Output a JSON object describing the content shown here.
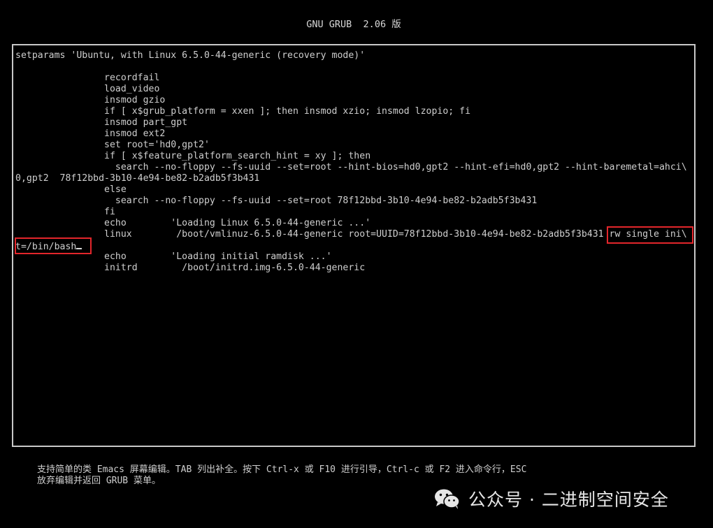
{
  "header": {
    "title": "GNU GRUB  2.06 版"
  },
  "editor": {
    "lines": [
      "setparams 'Ubuntu, with Linux 6.5.0-44-generic (recovery mode)'",
      "",
      "                recordfail",
      "                load_video",
      "                insmod gzio",
      "                if [ x$grub_platform = xxen ]; then insmod xzio; insmod lzopio; fi",
      "                insmod part_gpt",
      "                insmod ext2",
      "                set root='hd0,gpt2'",
      "                if [ x$feature_platform_search_hint = xy ]; then",
      "                  search --no-floppy --fs-uuid --set=root --hint-bios=hd0,gpt2 --hint-efi=hd0,gpt2 --hint-baremetal=ahci\\",
      "0,gpt2  78f12bbd-3b10-4e94-be82-b2adb5f3b431",
      "                else",
      "                  search --no-floppy --fs-uuid --set=root 78f12bbd-3b10-4e94-be82-b2adb5f3b431",
      "                fi",
      "                echo        'Loading Linux 6.5.0-44-generic ...'",
      "                linux        /boot/vmlinuz-6.5.0-44-generic root=UUID=78f12bbd-3b10-4e94-be82-b2adb5f3b431 rw single ini\\",
      "t=/bin/bash",
      "                echo        'Loading initial ramdisk ...'",
      "                initrd        /boot/initrd.img-6.5.0-44-generic"
    ]
  },
  "help": {
    "line1": "支持简单的类 Emacs 屏幕编辑。TAB 列出补全。按下 Ctrl-x 或 F10 进行引导，Ctrl-c 或 F2 进入命令行，ESC",
    "line2": "放弃编辑并返回 GRUB 菜单。"
  },
  "watermark": {
    "text": "公众号 · 二进制空间安全",
    "icon": "wechat-icon"
  },
  "colors": {
    "highlight": "#e3262b",
    "text": "#cfcfcf",
    "background": "#000000"
  }
}
